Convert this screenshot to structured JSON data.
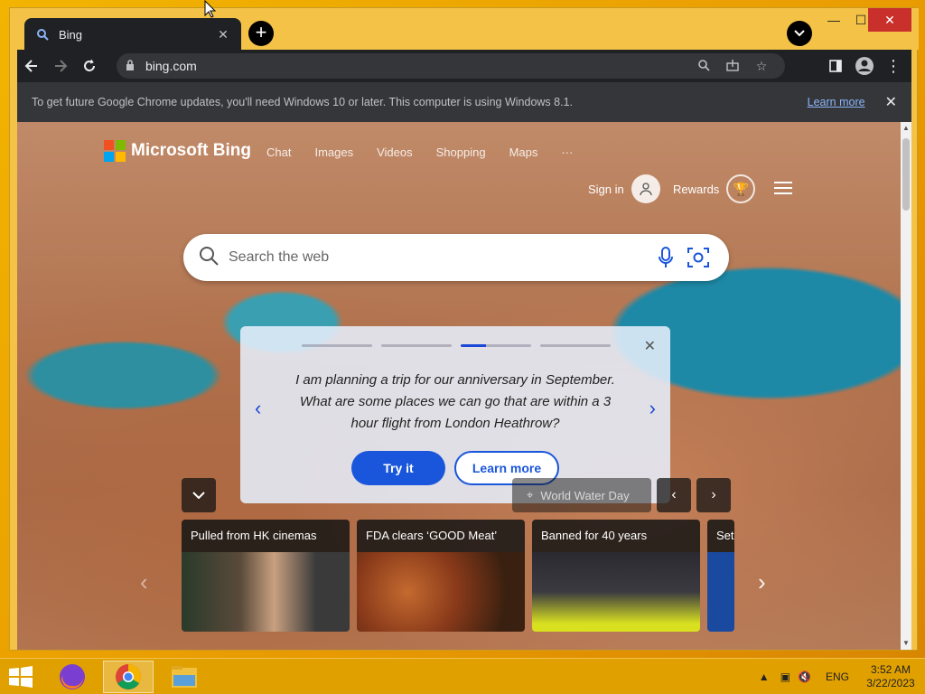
{
  "browser": {
    "tab_title": "Bing",
    "url": "bing.com",
    "infobar_message": "To get future Google Chrome updates, you'll need Windows 10 or later. This computer is using Windows 8.1.",
    "infobar_link": "Learn more"
  },
  "bing": {
    "brand": "Microsoft Bing",
    "nav": [
      "Chat",
      "Images",
      "Videos",
      "Shopping",
      "Maps",
      "···"
    ],
    "sign_in": "Sign in",
    "rewards": "Rewards",
    "search_placeholder": "Search the web"
  },
  "promo": {
    "text": "I am planning a trip for our anniversary in September. What are some places we can go that are within a 3 hour flight from London Heathrow?",
    "try_label": "Try it",
    "learn_label": "Learn more",
    "active_slide_index": 2,
    "slide_count": 4
  },
  "image_info": {
    "location": "World Water Day"
  },
  "news": [
    {
      "title": "Pulled from HK cinemas"
    },
    {
      "title": "FDA clears ‘GOOD Meat’"
    },
    {
      "title": "Banned for 40 years"
    },
    {
      "title": "Sets"
    }
  ],
  "taskbar": {
    "language": "ENG",
    "time": "3:52 AM",
    "date": "3/22/2023"
  },
  "colors": {
    "accent": "#1a56db",
    "desktop": "#f2b400",
    "chrome_dark": "#202124"
  }
}
